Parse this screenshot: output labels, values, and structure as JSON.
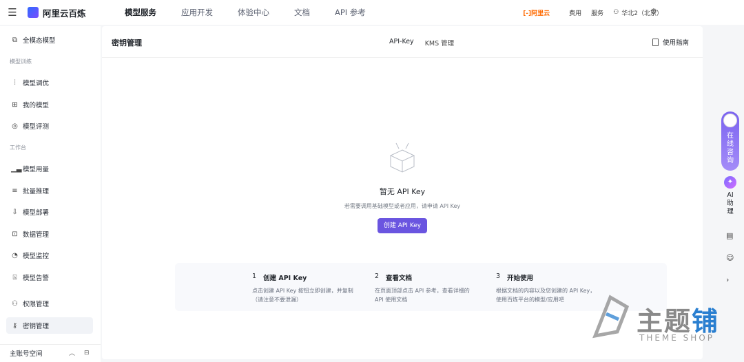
{
  "topbar": {
    "brand": "阿里云百炼",
    "nav": [
      "模型服务",
      "应用开发",
      "体验中心",
      "文档",
      "API 参考"
    ],
    "active_nav": "模型服务",
    "aliyun_logo": "[-]阿里云",
    "fees": "费用",
    "services": "服务",
    "region": "华北2（北京）"
  },
  "sidebar": {
    "items": [
      {
        "label": "全模态模型",
        "icon": "multimodal-icon"
      },
      {
        "group": "模型训练"
      },
      {
        "label": "模型调优",
        "icon": "tuning-icon"
      },
      {
        "label": "我的模型",
        "icon": "my-models-icon"
      },
      {
        "label": "模型评测",
        "icon": "evaluation-icon"
      },
      {
        "group": "工作台"
      },
      {
        "label": "模型用量",
        "icon": "usage-chart-icon"
      },
      {
        "label": "批量推理",
        "icon": "batch-icon"
      },
      {
        "label": "模型部署",
        "icon": "deploy-icon"
      },
      {
        "label": "数据管理",
        "icon": "data-icon"
      },
      {
        "label": "模型监控",
        "icon": "monitor-icon"
      },
      {
        "label": "模型告警",
        "icon": "alarm-icon"
      },
      {
        "label": "权限管理",
        "icon": "user-icon"
      },
      {
        "label": "密钥管理",
        "icon": "key-icon",
        "active": true
      }
    ],
    "account": "主账号空间"
  },
  "main": {
    "title": "密钥管理",
    "tabs": [
      "API-Key",
      "KMS 管理"
    ],
    "guide": "使用指南",
    "empty": {
      "title": "暂无 API Key",
      "desc": "若需要调用基础模型或者应用，请申请 API Key",
      "button": "创建 API Key"
    },
    "steps": [
      {
        "num": "1",
        "title": "创建 API Key",
        "desc": "点击创建 API Key 按钮立即创建，并复制（请注意不要泄漏）"
      },
      {
        "num": "2",
        "title": "查看文档",
        "desc": "在页面顶部点击 API 参考，查看详细的 API 使用文档"
      },
      {
        "num": "3",
        "title": "开始使用",
        "desc": "根据文档的内容以及您创建的 API Key，使用百炼平台的模型/应用吧"
      }
    ]
  },
  "rail": {
    "consult": "在线咨询",
    "ai_assistant": "AI助理"
  },
  "watermark": {
    "cn_gray": "主题",
    "cn_blue": "铺",
    "en": "THEME SHOP"
  },
  "colors": {
    "accent": "#6a55e0",
    "brand_orange": "#ff6a00"
  }
}
